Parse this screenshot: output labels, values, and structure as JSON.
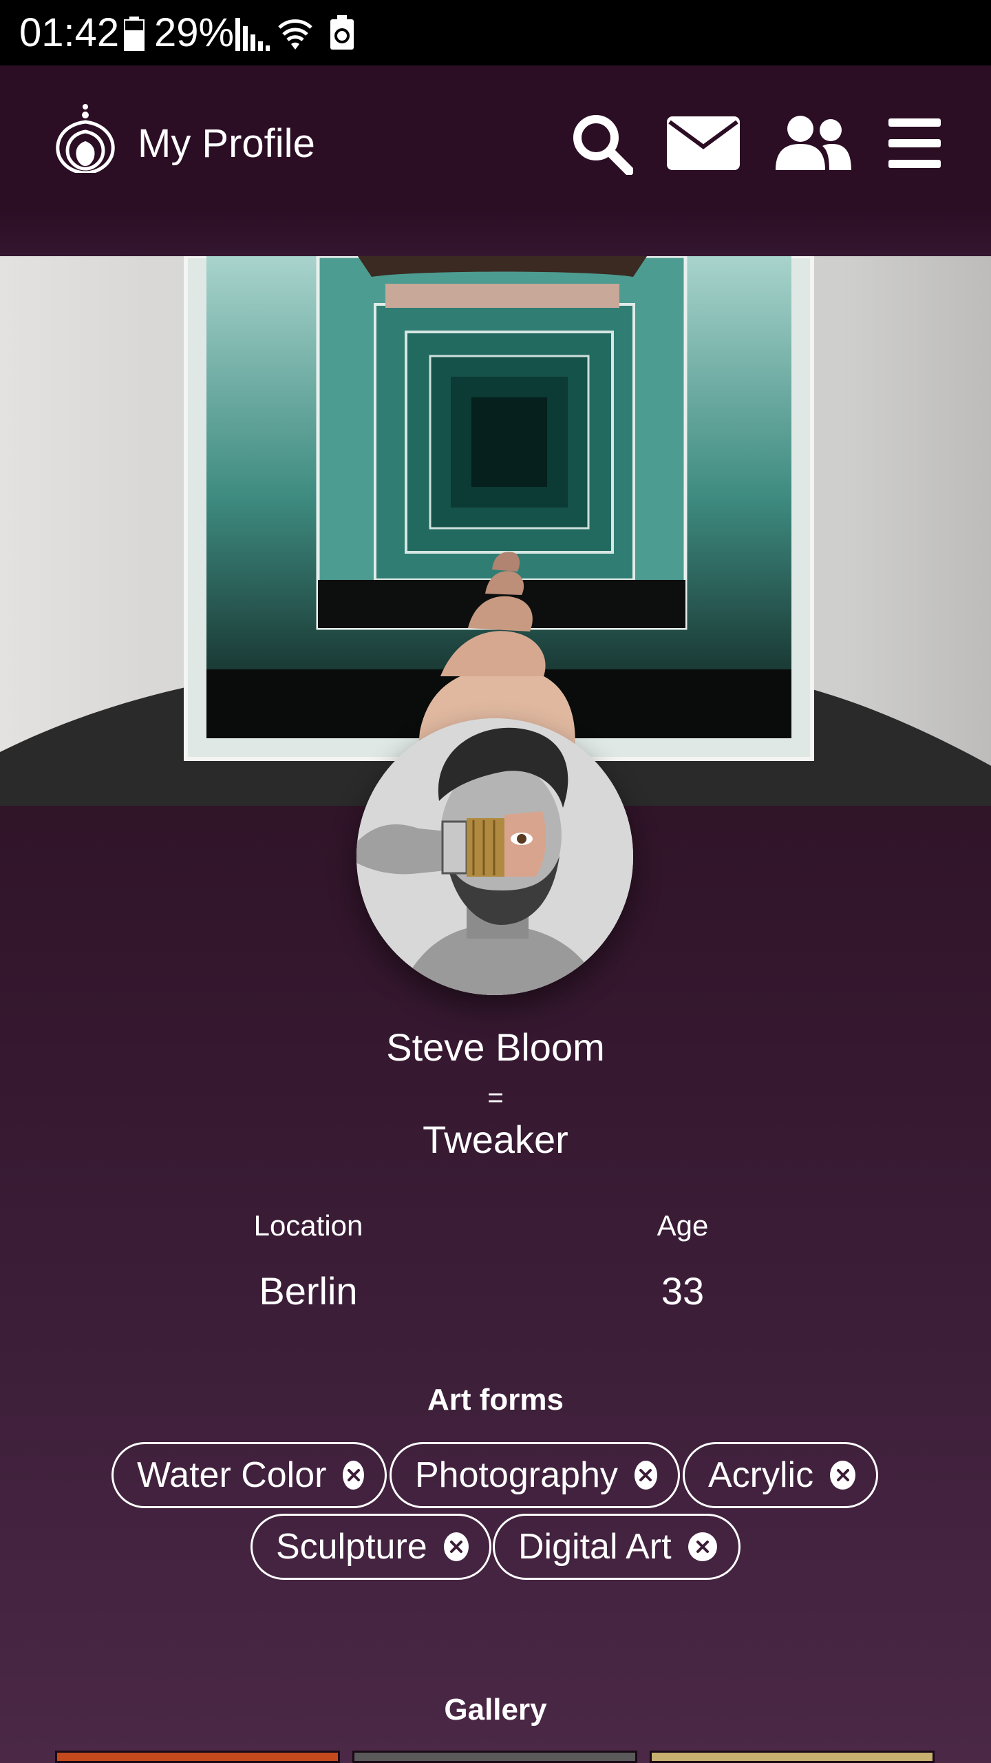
{
  "status_bar": {
    "time": "01:42",
    "battery_percent": "29%",
    "icons": [
      "battery-icon",
      "signal-icon",
      "wifi-icon",
      "battery-saver-icon"
    ]
  },
  "header": {
    "title": "My Profile",
    "icons": [
      "search-icon",
      "mail-icon",
      "friends-icon",
      "menu-icon"
    ]
  },
  "profile": {
    "name": "Steve Bloom",
    "separator": "=",
    "role": "Tweaker",
    "location_label": "Location",
    "location_value": "Berlin",
    "age_label": "Age",
    "age_value": "33"
  },
  "art_forms": {
    "title": "Art forms",
    "chips": [
      "Water Color",
      "Photography",
      "Acrylic",
      "Sculpture",
      "Digital Art"
    ]
  },
  "gallery": {
    "title": "Gallery"
  },
  "colors": {
    "background": "#2b0d24",
    "accent": "#ffffff",
    "status_bar": "#000000"
  }
}
